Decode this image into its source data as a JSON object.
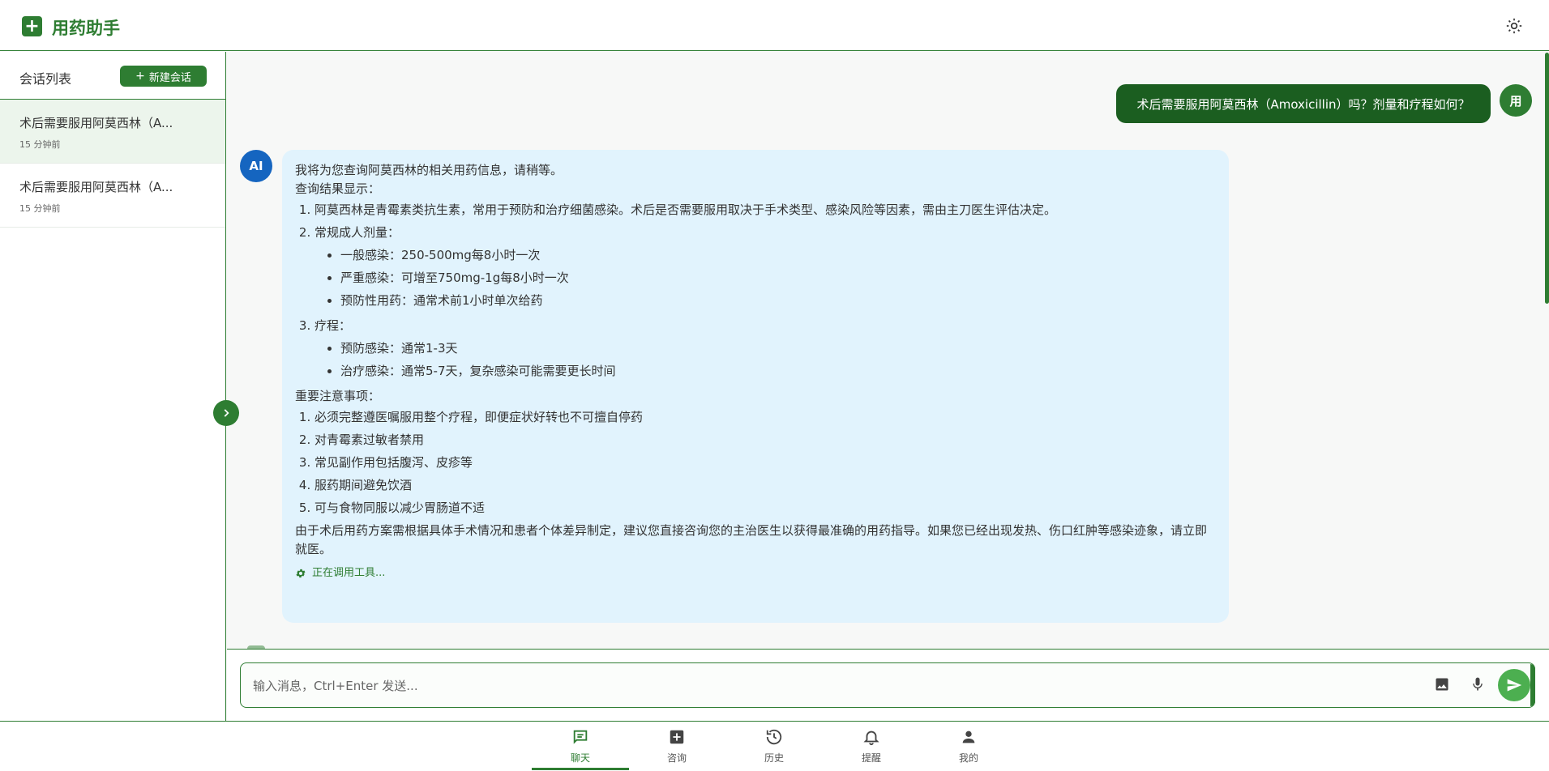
{
  "app": {
    "title": "用药助手"
  },
  "sidebar": {
    "title": "会话列表",
    "new_button": "新建会话",
    "conversations": [
      {
        "title": "术后需要服用阿莫西林（A...",
        "time": "15 分钟前"
      },
      {
        "title": "术后需要服用阿莫西林（A...",
        "time": "15 分钟前"
      }
    ]
  },
  "chat": {
    "user_message": "术后需要服用阿莫西林（Amoxicillin）吗？剂量和疗程如何？",
    "user_avatar": "用",
    "ai_avatar": "AI",
    "ai": {
      "intro": "我将为您查询阿莫西林的相关用药信息，请稍等。",
      "result_heading": "查询结果显示：",
      "result_item_1": "阿莫西林是青霉素类抗生素，常用于预防和治疗细菌感染。术后是否需要服用取决于手术类型、感染风险等因素，需由主刀医生评估决定。",
      "result_item_2": "常规成人剂量：",
      "dosage": [
        "一般感染：250-500mg每8小时一次",
        "严重感染：可增至750mg-1g每8小时一次",
        "预防性用药：通常术前1小时单次给药"
      ],
      "result_item_3": "疗程：",
      "course": [
        "预防感染：通常1-3天",
        "治疗感染：通常5-7天，复杂感染可能需要更长时间"
      ],
      "notes_heading": "重要注意事项：",
      "notes": [
        "必须完整遵医嘱服用整个疗程，即便症状好转也不可擅自停药",
        "对青霉素过敏者禁用",
        "常见副作用包括腹泻、皮疹等",
        "服药期间避免饮酒",
        "可与食物同服以减少胃肠道不适"
      ],
      "conclusion": "由于术后用药方案需根据具体手术情况和患者个体差异制定，建议您直接咨询您的主治医生以获得最准确的用药指导。如果您已经出现发热、伤口红肿等感染迹象，请立即就医。",
      "tool_status": "正在调用工具..."
    }
  },
  "input": {
    "placeholder": "输入消息，Ctrl+Enter 发送..."
  },
  "nav": {
    "items": [
      {
        "label": "聊天",
        "icon": "chat-icon"
      },
      {
        "label": "咨询",
        "icon": "add-box-icon"
      },
      {
        "label": "历史",
        "icon": "history-icon"
      },
      {
        "label": "提醒",
        "icon": "bell-icon"
      },
      {
        "label": "我的",
        "icon": "person-icon"
      }
    ]
  },
  "colors": {
    "primary": "#2e7d32",
    "user_bubble": "#1b5e20",
    "ai_bubble": "#e1f3fd",
    "ai_avatar": "#1565c0",
    "send": "#4caf50"
  }
}
